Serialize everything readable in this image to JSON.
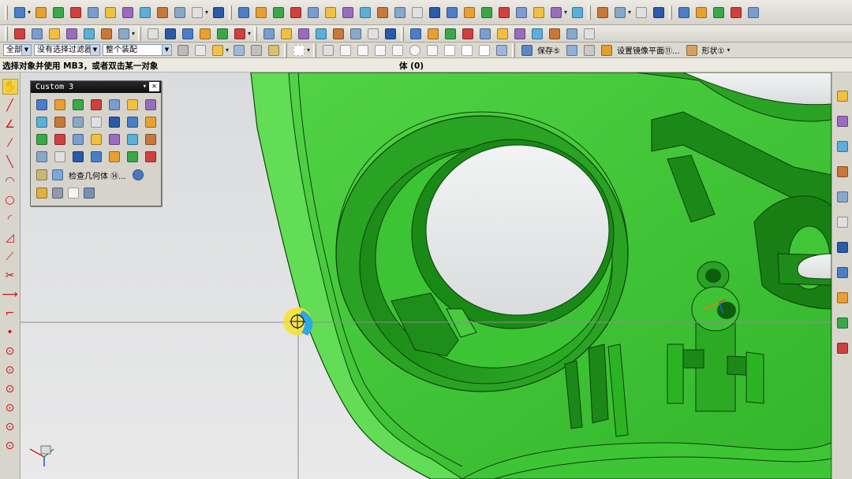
{
  "window": {
    "prompt": "选择对象并使用 MB3，或者双击某一对象",
    "selection_info": "体 (0)"
  },
  "selection_bar": {
    "type_filter": "全部",
    "filter_option": "没有选择过滤器",
    "scope": "整个装配",
    "save_label": "保存⑤",
    "mirror_plane_label": "设置镜像平面⑪...",
    "shape_label": "形状①"
  },
  "custom_toolbar": {
    "title": "Custom 3",
    "check_geometry_label": "检查几何体 ⑭..."
  },
  "colors": {
    "model_green": "#44c93a",
    "model_dark": "#137a12",
    "model_edge": "#0b3f09",
    "viewport_bg": "#dedfe0",
    "crosshair": "#8d8d8d"
  },
  "toolbar_row1_icons": [
    "new-file-icon",
    "blueprint-icon",
    "shield-icon",
    "cylinder-icon",
    "nx-logo-icon",
    "box-icon",
    "shell-icon",
    "chain-icon",
    "sphere-icon",
    "cylinder-blue-icon",
    "cube-icon",
    "cone-icon",
    "extrude-icon",
    "revolve-icon",
    "sweep-icon",
    "trim-icon",
    "rotate-icon",
    "sketch-icon",
    "blend-icon",
    "boolean-icon",
    "cut-icon",
    "unite-icon",
    "subtract-icon",
    "intersect-icon",
    "mirror-icon",
    "offset-icon",
    "draft-icon",
    "chamfer-icon",
    "edge-blend-icon",
    "face-blend-icon",
    "measure-icon",
    "point-icon",
    "plane-icon",
    "axis-icon",
    "csys-icon",
    "curve-icon",
    "helix-icon",
    "spline-icon",
    "text-icon",
    "bridge-icon",
    "fillet-curve-icon"
  ],
  "toolbar_row2_icons": [
    "layer-icon",
    "wizard-icon",
    "select-arrow-icon",
    "snap-icon",
    "pick-icon",
    "ruler-icon",
    "grid-icon",
    "line-icon",
    "arc-icon",
    "rectangle-icon",
    "polygon-icon",
    "text-tool-icon",
    "spline-tool-icon",
    "fit-icon",
    "offset-curve-icon",
    "project-icon",
    "intersect-curve-icon",
    "section-curve-icon",
    "extract-icon",
    "wrap-icon",
    "hide-icon",
    "show-icon",
    "render-icon",
    "material-icon",
    "light-icon",
    "camera-icon",
    "scene-icon",
    "export-icon",
    "image-icon",
    "plot-icon",
    "print-icon",
    "help-icon"
  ],
  "left_tools": [
    "select-icon",
    "line-icon",
    "angle-icon",
    "curve-icon",
    "spline-icon",
    "arc-icon",
    "circle-icon",
    "fillet-icon",
    "chamfer-icon",
    "offset-icon",
    "trim-icon",
    "extend-icon",
    "corner-icon",
    "point-icon",
    "circle-center-icon",
    "circle-quad-icon",
    "circle-tangent-icon",
    "circle-edge-icon",
    "ellipse-icon",
    "polygon-icon"
  ],
  "right_tools": [
    "assembly-navigator-icon",
    "part-navigator-icon",
    "history-icon",
    "web-browser-icon",
    "reuse-library-icon",
    "clock-icon",
    "process-icon",
    "palette-icon",
    "role-icon",
    "system-materials-icon",
    "visualization-icon"
  ]
}
